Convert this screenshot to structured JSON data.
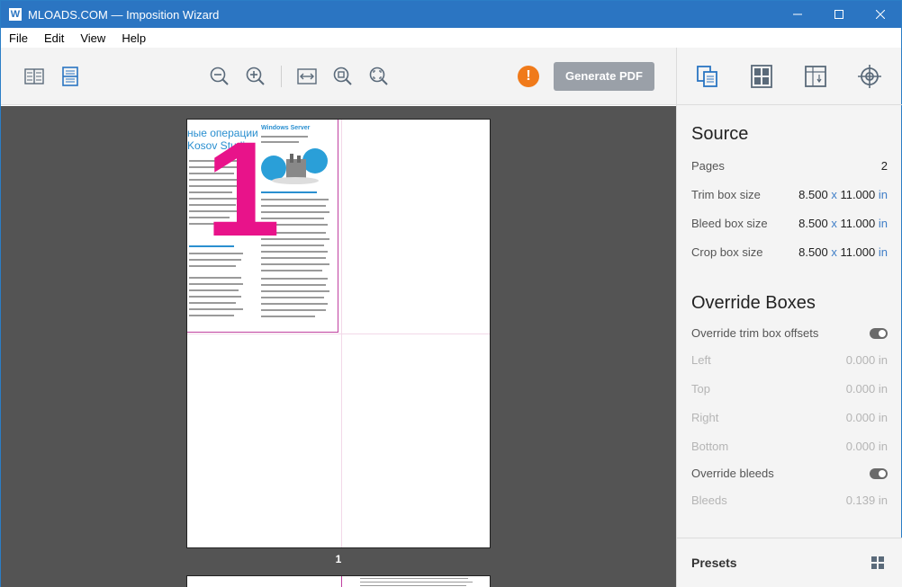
{
  "window": {
    "title": "MLOADS.COM — Imposition Wizard",
    "app_icon": "W"
  },
  "menu": {
    "items": [
      "File",
      "Edit",
      "View",
      "Help"
    ]
  },
  "toolbar": {
    "warning_glyph": "!",
    "generate_label": "Generate PDF"
  },
  "canvas": {
    "page_number": "1",
    "page_big_number": "1",
    "sheet_headline": "ные операции",
    "sheet_subhead": "Kosov Studio",
    "sheet_col2_title": "Windows Server"
  },
  "sidebar": {
    "source": {
      "title": "Source",
      "pages_label": "Pages",
      "pages_value": "2",
      "trim_label": "Trim box size",
      "bleed_label": "Bleed box size",
      "crop_label": "Crop box size",
      "width": "8.500",
      "height": "11.000",
      "x_sep": "x",
      "unit": "in"
    },
    "override": {
      "title": "Override Boxes",
      "trim_offsets_label": "Override trim box offsets",
      "left_label": "Left",
      "top_label": "Top",
      "right_label": "Right",
      "bottom_label": "Bottom",
      "zero_value": "0.000",
      "bleeds_label": "Override bleeds",
      "bleeds_row_label": "Bleeds",
      "bleeds_value": "0.139",
      "unit": "in"
    },
    "presets_label": "Presets"
  },
  "colors": {
    "titlebar": "#2b75c2",
    "accent": "#3f7ec7",
    "warning": "#f07a1a",
    "page_number": "#e8138a"
  }
}
